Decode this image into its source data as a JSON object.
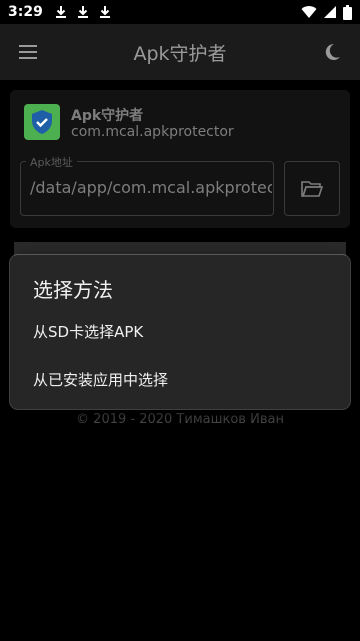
{
  "status_bar": {
    "time": "3:29"
  },
  "toolbar": {
    "title": "Apk守护者"
  },
  "app_card": {
    "app_name": "Apk守护者",
    "package": "com.mcal.apkprotector",
    "path_label": "Apk地址",
    "path_value": "/data/app/com.mcal.apkprotect"
  },
  "dialog": {
    "title": "选择方法",
    "options": [
      "从SD卡选择APK",
      "从已安装应用中选择"
    ]
  },
  "footer": {
    "text": "© 2019 - 2020 Тимашков Иван"
  },
  "colors": {
    "background": "#000000",
    "toolbar": "#1b1b1b",
    "dialog": "#262626",
    "app_icon": "#4caf50"
  }
}
